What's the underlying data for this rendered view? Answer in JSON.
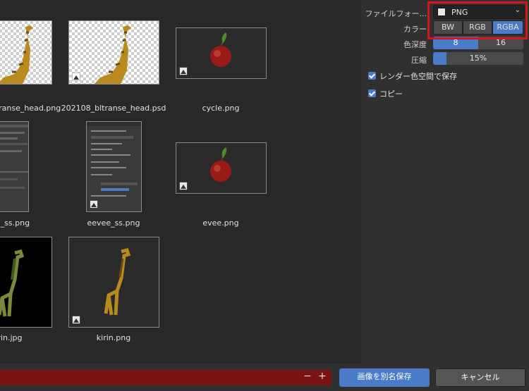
{
  "files": [
    {
      "caption": "bltranse_head.png",
      "kind": "giraffe-transparent"
    },
    {
      "caption": "202108_bltranse_head.psd",
      "kind": "giraffe-transparent"
    },
    {
      "caption": "cycle.png",
      "kind": "apple"
    },
    {
      "caption": "e_ss.png",
      "kind": "screenshot"
    },
    {
      "caption": "eevee_ss.png",
      "kind": "screenshot"
    },
    {
      "caption": "evee.png",
      "kind": "apple"
    },
    {
      "caption": "rin.jpg",
      "kind": "giraffe-black"
    },
    {
      "caption": "kirin.png",
      "kind": "giraffe-dark"
    }
  ],
  "settings": {
    "file_format_label": "ファイルフォー...",
    "file_format_value": "PNG",
    "color_label": "カラー",
    "color_options": [
      "BW",
      "RGB",
      "RGBA"
    ],
    "color_selected": "RGBA",
    "depth_label": "色深度",
    "depth_options": [
      "8",
      "16"
    ],
    "depth_selected": "8",
    "compression_label": "圧縮",
    "compression_value": "15%",
    "compression_fraction": 0.15,
    "render_colorspace_label": "レンダー色空間で保存",
    "render_colorspace_checked": true,
    "copy_label": "コピー",
    "copy_checked": true
  },
  "footer": {
    "filename_value": "",
    "minus": "−",
    "plus": "+",
    "save_label": "画像を別名保存",
    "cancel_label": "キャンセル"
  },
  "colors": {
    "accent": "#4a7bc8",
    "filename_bg": "#7a1414",
    "highlight": "#d4161d"
  }
}
